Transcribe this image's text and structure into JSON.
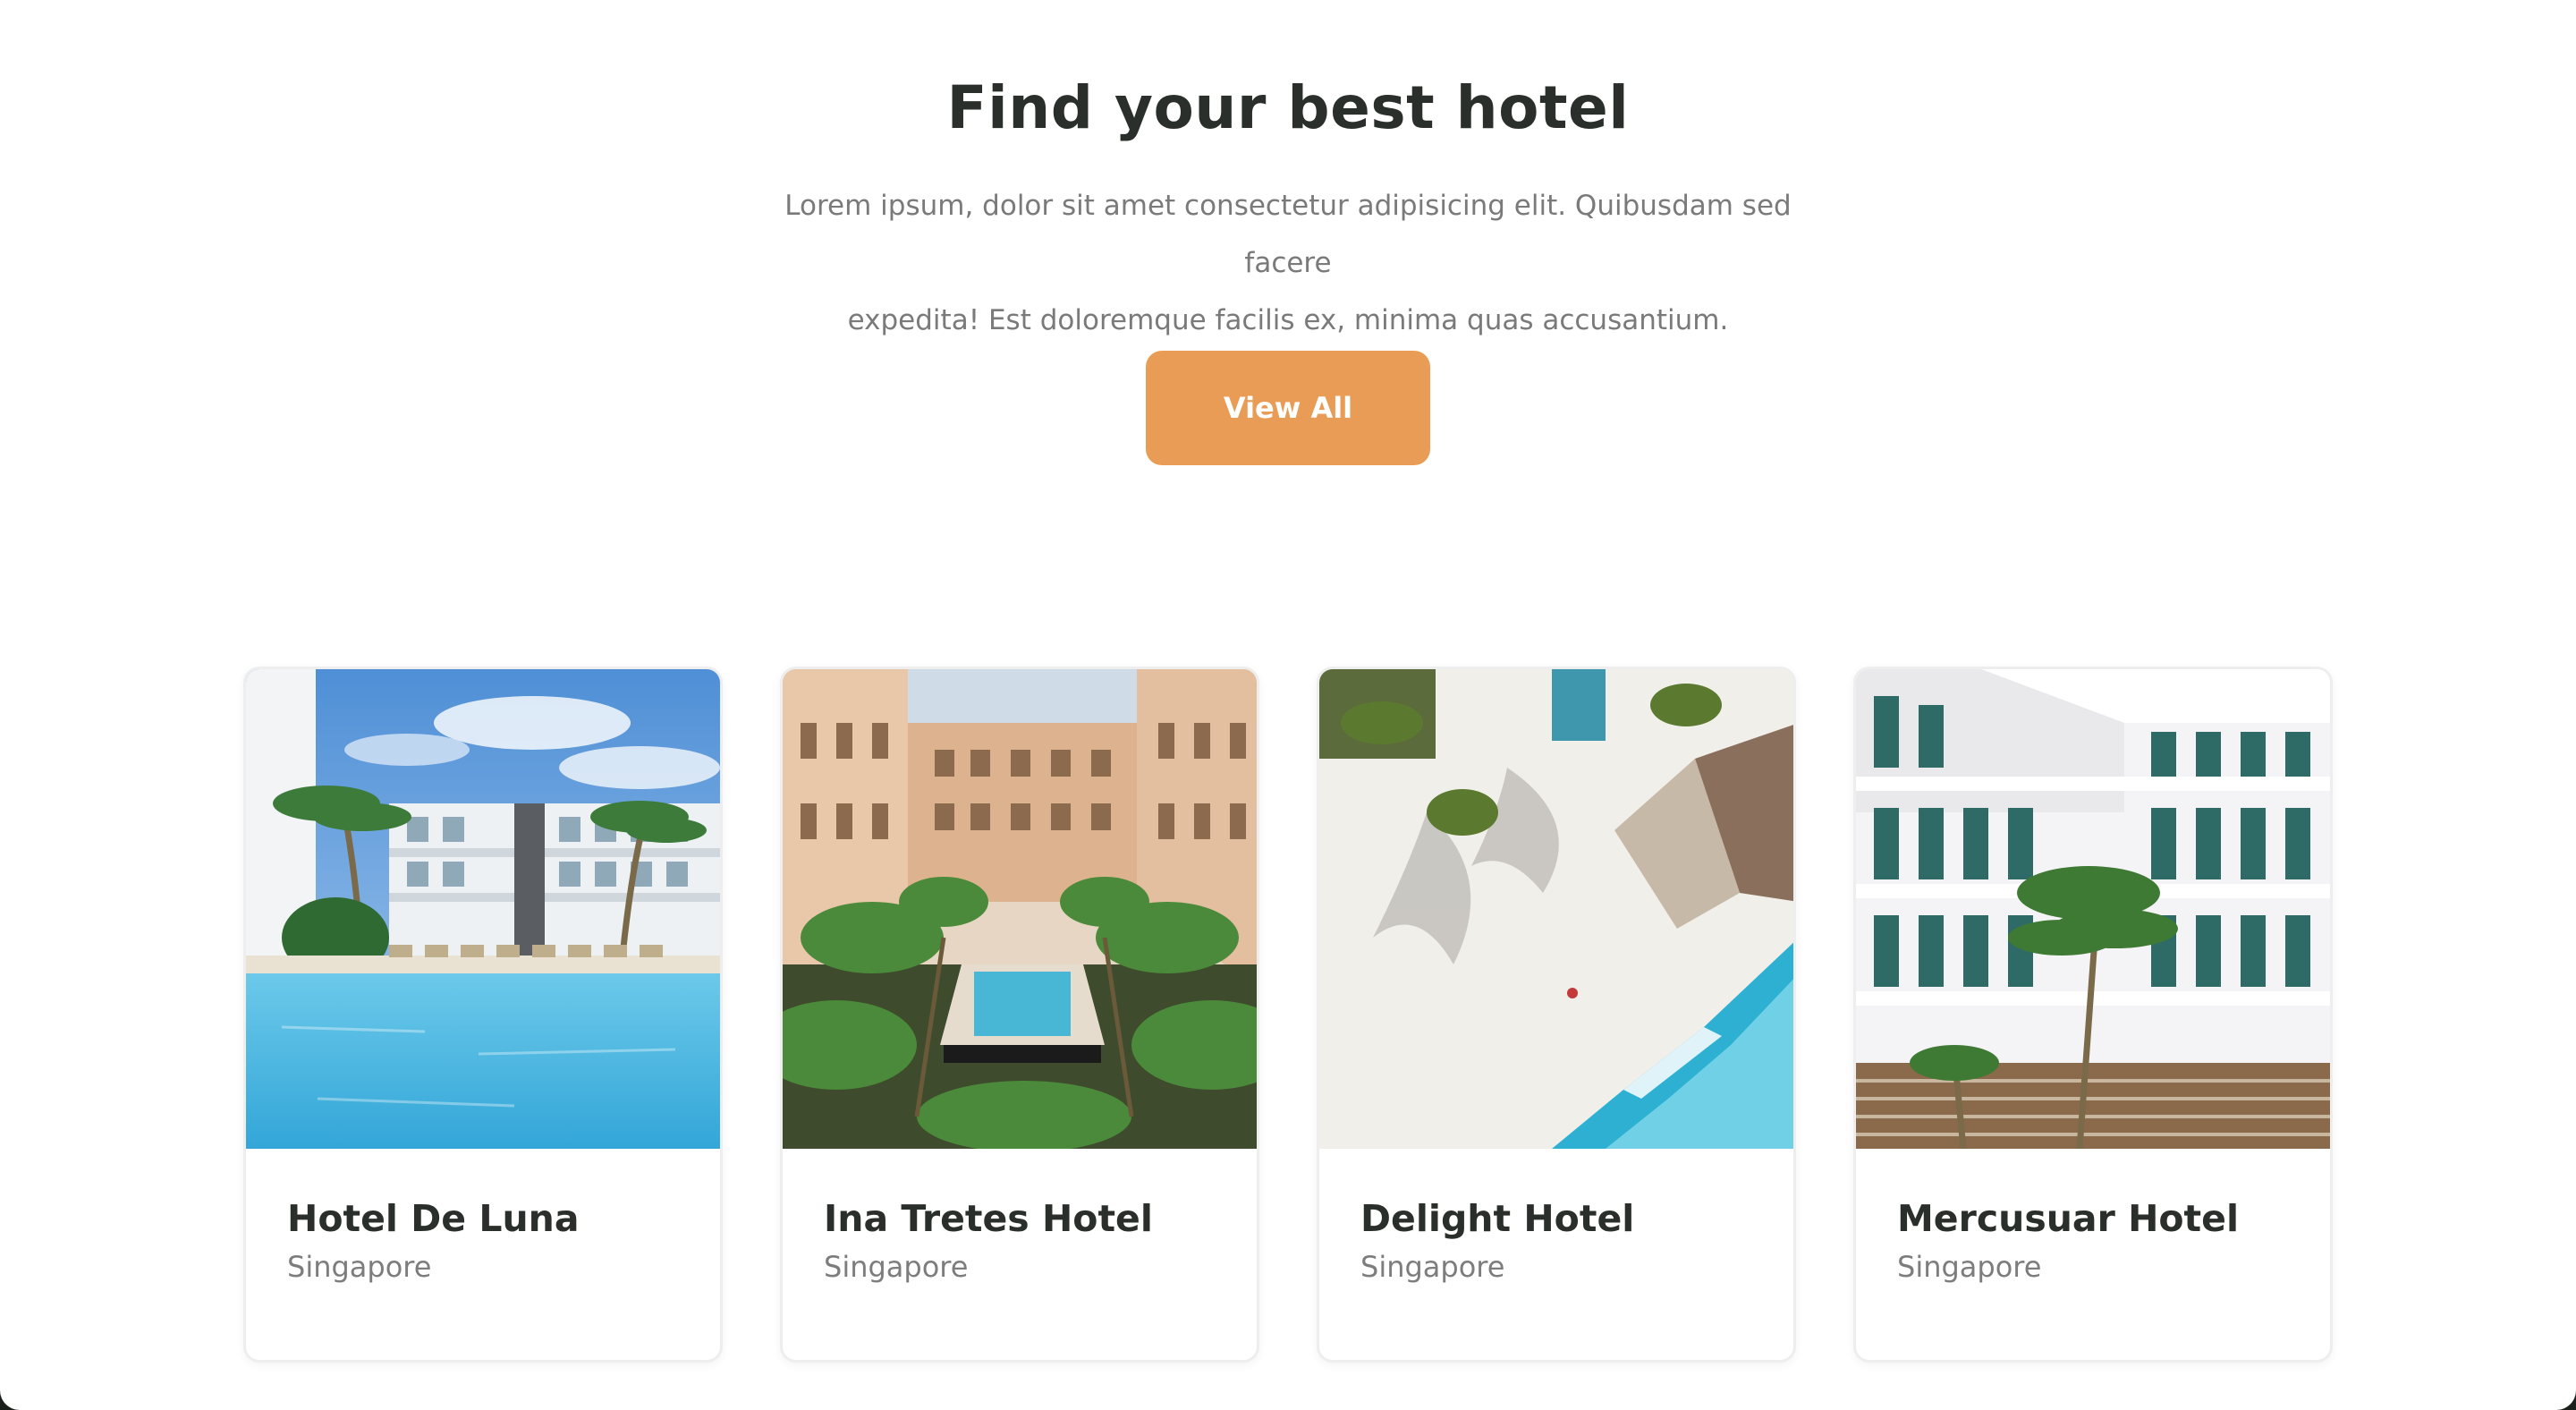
{
  "hero": {
    "title": "Find your best hotel",
    "description_line1": "Lorem ipsum, dolor sit amet consectetur adipisicing elit. Quibusdam sed facere",
    "description_line2": "expedita! Est doloremque facilis ex, minima quas accusantium.",
    "button_label": "View All"
  },
  "colors": {
    "accent": "#e89c55",
    "title": "#2b2f2c",
    "muted": "#7a7a7a"
  },
  "hotels": [
    {
      "name": "Hotel De Luna",
      "location": "Singapore"
    },
    {
      "name": "Ina Tretes Hotel",
      "location": "Singapore"
    },
    {
      "name": "Delight Hotel",
      "location": "Singapore"
    },
    {
      "name": "Mercusuar Hotel",
      "location": "Singapore"
    }
  ]
}
